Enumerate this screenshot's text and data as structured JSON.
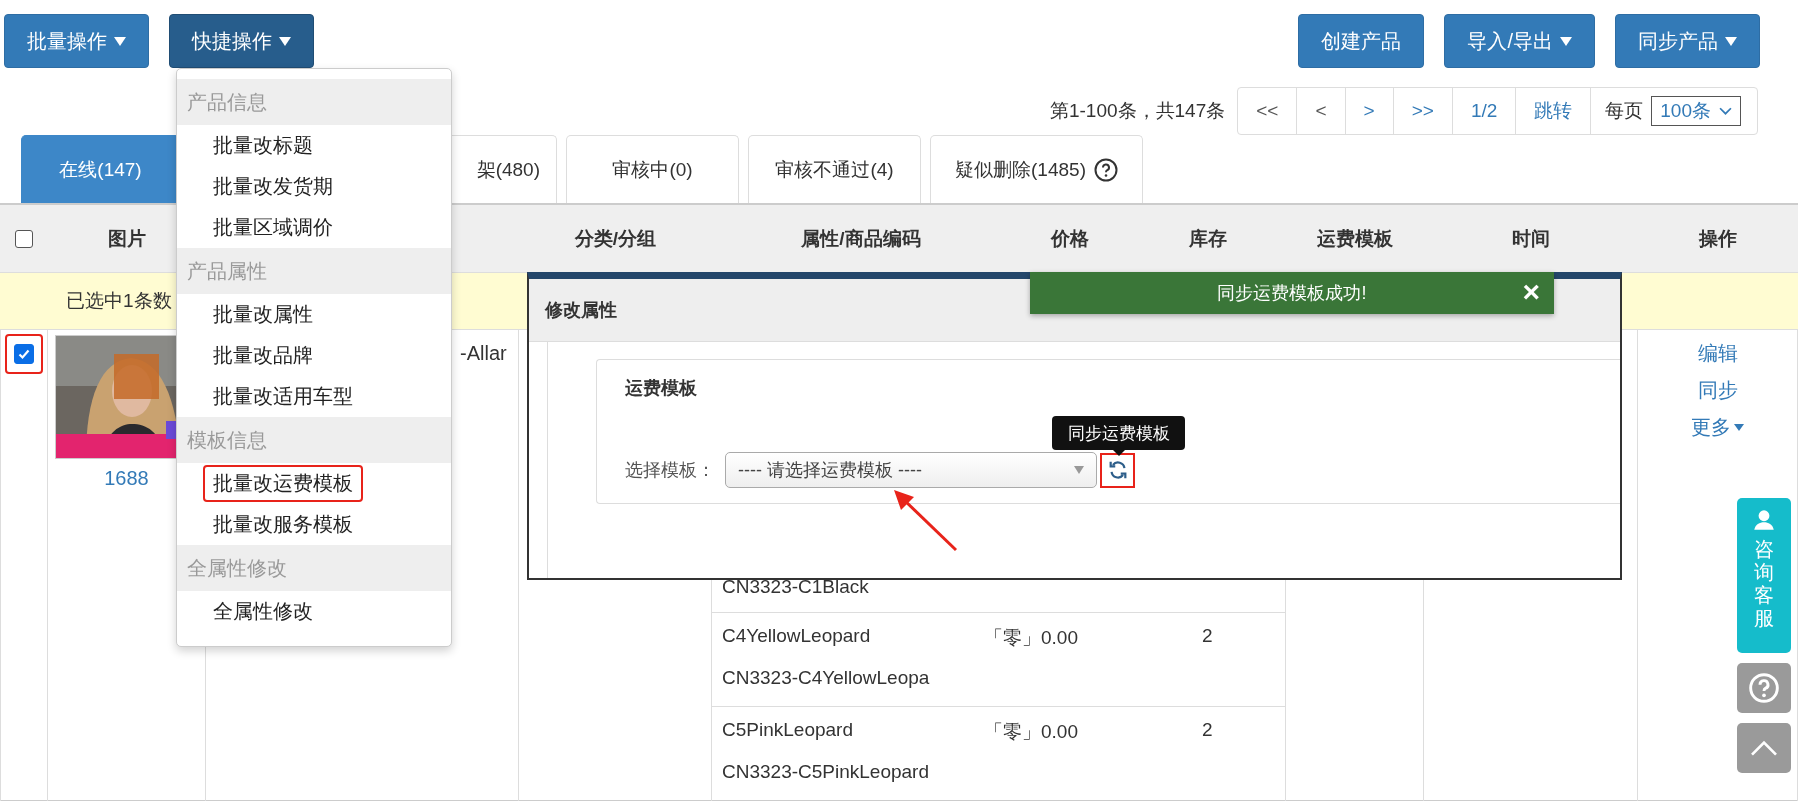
{
  "toolbar": {
    "left_buttons": [
      {
        "label": "批量操作",
        "caret": true,
        "selected": false
      },
      {
        "label": "快捷操作",
        "caret": true,
        "selected": true
      }
    ],
    "right_buttons": [
      {
        "label": "创建产品",
        "caret": false
      },
      {
        "label": "导入/导出",
        "caret": true
      },
      {
        "label": "同步产品",
        "caret": true
      }
    ]
  },
  "pagination": {
    "summary": "第1-100条，共147条",
    "buttons": [
      {
        "label": "<<",
        "disabled": true
      },
      {
        "label": "<",
        "disabled": true
      },
      {
        "label": ">",
        "disabled": false
      },
      {
        "label": ">>",
        "disabled": false
      }
    ],
    "page": "1/2",
    "jump": "跳转",
    "per_page_label": "每页",
    "per_page": "100条"
  },
  "tabs": [
    {
      "label": "在线(147)",
      "selected": true,
      "help": false
    },
    {
      "label": "架(480)",
      "selected": false,
      "help": false
    },
    {
      "label": "审核中(0)",
      "selected": false,
      "help": false
    },
    {
      "label": "审核不通过(4)",
      "selected": false,
      "help": false
    },
    {
      "label": "疑似删除(1485)",
      "selected": false,
      "help": true
    }
  ],
  "table": {
    "select_all": {
      "checked": false
    },
    "columns": [
      "图片",
      "分类/分组",
      "属性/商品编码",
      "价格",
      "库存",
      "运费模板",
      "时间",
      "操作"
    ],
    "selection_notice": "已选中1条数",
    "rows": [
      {
        "checked": true,
        "highlighted": true,
        "source": "1688",
        "title": "-Allar",
        "variants": [
          {
            "code": "CN3323-C1Black"
          },
          {
            "name": "C4YellowLeopard",
            "code": "CN3323-C4YellowLeopa",
            "price": "「零」0.00",
            "stock": "2"
          },
          {
            "name": "C5PinkLeopard",
            "code": "CN3323-C5PinkLeopard",
            "price": "「零」0.00",
            "stock": "2"
          }
        ],
        "actions": [
          {
            "label": "编辑",
            "caret": false
          },
          {
            "label": "同步",
            "caret": false
          },
          {
            "label": "更多",
            "caret": true
          }
        ]
      }
    ]
  },
  "dropdown": {
    "groups": [
      {
        "title": "产品信息",
        "items": [
          {
            "label": "批量改标题",
            "highlighted": false
          },
          {
            "label": "批量改发货期",
            "highlighted": false
          },
          {
            "label": "批量区域调价",
            "highlighted": false
          }
        ]
      },
      {
        "title": "产品属性",
        "items": [
          {
            "label": "批量改属性",
            "highlighted": false
          },
          {
            "label": "批量改品牌",
            "highlighted": false
          },
          {
            "label": "批量改适用车型",
            "highlighted": false
          }
        ]
      },
      {
        "title": "模板信息",
        "items": [
          {
            "label": "批量改运费模板",
            "highlighted": true
          },
          {
            "label": "批量改服务模板",
            "highlighted": false
          }
        ]
      },
      {
        "title": "全属性修改",
        "items": [
          {
            "label": "全属性修改",
            "highlighted": false
          }
        ]
      }
    ]
  },
  "modal": {
    "title": "修改属性",
    "section": "运费模板",
    "field_label": "选择模板：",
    "value": "---- 请选择运费模板 ----",
    "sync_highlighted": true,
    "tooltip": "同步运费模板"
  },
  "toast": {
    "message": "同步运费模板成功!",
    "close": "×"
  },
  "float_bar": {
    "service_label": "咨询客服"
  }
}
